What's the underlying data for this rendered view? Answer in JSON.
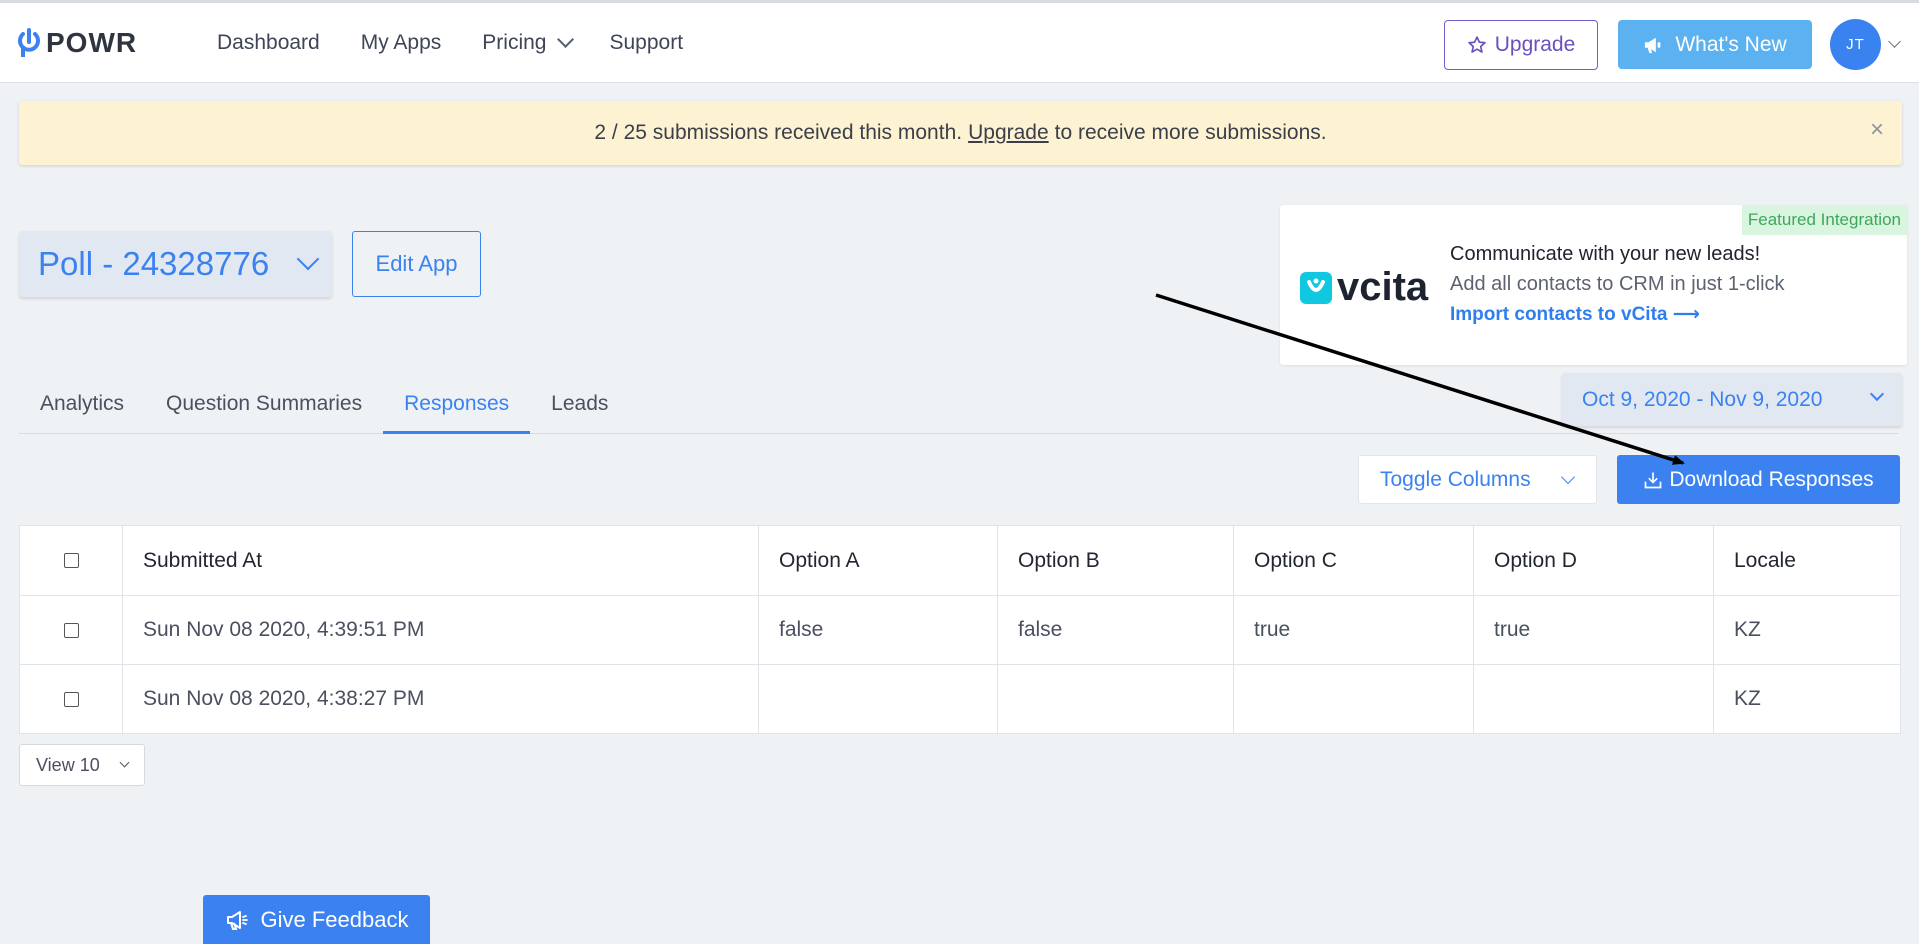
{
  "brand": {
    "name": "POWR",
    "accent": "#3b82f0"
  },
  "nav": {
    "items": [
      {
        "label": "Dashboard"
      },
      {
        "label": "My Apps"
      },
      {
        "label": "Pricing",
        "has_dropdown": true
      },
      {
        "label": "Support"
      }
    ],
    "upgrade_label": "Upgrade",
    "whats_new_label": "What's New",
    "avatar_initials": "JT"
  },
  "banner": {
    "text_before": "2 / 25 submissions received this month.",
    "link": "Upgrade",
    "text_after": "to receive more submissions.",
    "close": "×"
  },
  "app": {
    "name": "Poll - 24328776",
    "edit_label": "Edit App"
  },
  "integration": {
    "badge": "Featured Integration",
    "logo_text": "vcita",
    "title": "Communicate with your new leads!",
    "subtitle": "Add all contacts to CRM in just 1-click",
    "link": "Import contacts to vCita ⟶"
  },
  "date_range": "Oct 9, 2020 - Nov 9, 2020",
  "tabs": [
    {
      "label": "Analytics"
    },
    {
      "label": "Question Summaries"
    },
    {
      "label": "Responses",
      "active": true
    },
    {
      "label": "Leads"
    }
  ],
  "toolbar": {
    "toggle_label": "Toggle Columns",
    "download_label": "Download Responses"
  },
  "table": {
    "headers": [
      "Submitted At",
      "Option A",
      "Option B",
      "Option C",
      "Option D",
      "Locale"
    ],
    "rows": [
      [
        "Sun Nov 08 2020, 4:39:51 PM",
        "false",
        "false",
        "true",
        "true",
        "KZ"
      ],
      [
        "Sun Nov 08 2020, 4:38:27 PM",
        "",
        "",
        "",
        "",
        "KZ"
      ]
    ]
  },
  "view_select": "View 10",
  "feedback_label": "Give Feedback"
}
